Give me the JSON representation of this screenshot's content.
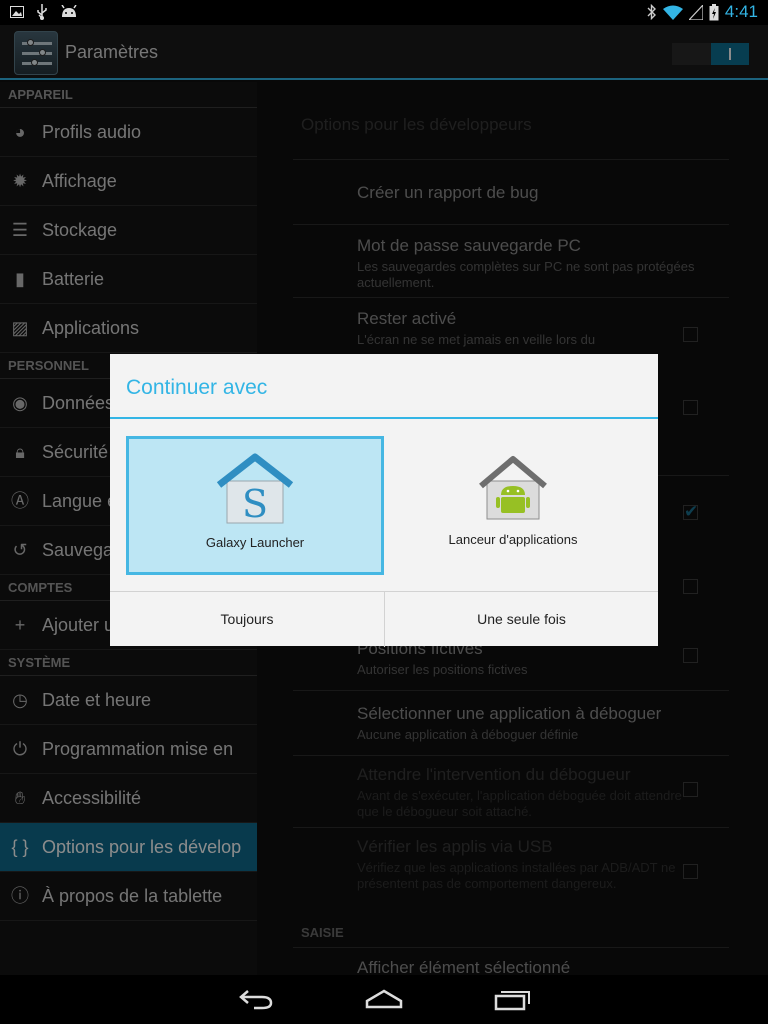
{
  "status_bar": {
    "time": "4:41",
    "left_icons": [
      "image-icon",
      "usb-icon",
      "android-debug-icon"
    ],
    "right_icons": [
      "bluetooth-icon",
      "wifi-icon",
      "signal-icon",
      "battery-icon"
    ]
  },
  "action_bar": {
    "title": "Paramètres",
    "app_icon": "settings-sliders-icon"
  },
  "sidebar": {
    "headers": {
      "appareil": "APPAREIL",
      "personnel": "PERSONNEL",
      "comptes": "COMPTES",
      "systeme": "SYSTÈME"
    },
    "items": [
      {
        "label": "Profils audio",
        "icon": "audio-profiles-icon"
      },
      {
        "label": "Affichage",
        "icon": "display-icon"
      },
      {
        "label": "Stockage",
        "icon": "storage-icon"
      },
      {
        "label": "Batterie",
        "icon": "battery-icon"
      },
      {
        "label": "Applications",
        "icon": "apps-icon"
      },
      {
        "label": "Données",
        "icon": "location-icon"
      },
      {
        "label": "Sécurité",
        "icon": "lock-icon"
      },
      {
        "label": "Langue e",
        "icon": "language-icon"
      },
      {
        "label": "Sauvega",
        "icon": "backup-icon"
      },
      {
        "label": "Ajouter un compte",
        "icon": "plus-icon"
      },
      {
        "label": "Date et heure",
        "icon": "clock-icon"
      },
      {
        "label": "Programmation mise en",
        "icon": "power-schedule-icon"
      },
      {
        "label": "Accessibilité",
        "icon": "hand-icon"
      },
      {
        "label": "Options pour les dévelop",
        "icon": "braces-icon"
      },
      {
        "label": "À propos de la tablette",
        "icon": "info-icon"
      }
    ]
  },
  "pane": {
    "title": "Options pour les développeurs",
    "prefs": [
      {
        "title": "Créer un rapport de bug",
        "summary": ""
      },
      {
        "title": "Mot de passe sauvegarde PC",
        "summary": "Les sauvegardes complètes sur PC ne sont pas protégées actuellement."
      },
      {
        "title": "Rester activé",
        "summary": "L'écran ne se met jamais en veille lors du"
      },
      {
        "title": "Positions fictives",
        "summary": "Autoriser les positions fictives"
      },
      {
        "title": "Sélectionner une application à déboguer",
        "summary": "Aucune application à déboguer définie"
      },
      {
        "title": "Attendre l'intervention du débogueur",
        "summary": "Avant de s'exécuter, l'application déboguée doit attendre que le débogueur soit attaché."
      },
      {
        "title": "Vérifier les applis via USB",
        "summary": "Vérifiez que les applications installées par ADB/ADT ne présentent pas de comportement dangereux."
      },
      {
        "title": "Afficher élément sélectionné",
        "summary": ""
      }
    ],
    "section_saisie": "SAISIE"
  },
  "dialog": {
    "title": "Continuer avec",
    "options": [
      {
        "label": "Galaxy Launcher",
        "icon": "galaxy-launcher-icon",
        "selected": true
      },
      {
        "label": "Lanceur d'applications",
        "icon": "android-launcher-icon",
        "selected": false
      }
    ],
    "always_label": "Toujours",
    "once_label": "Une seule fois",
    "galaxy_glyph": "S"
  },
  "nav_bar": {
    "icons": [
      "back-icon",
      "home-icon",
      "recents-icon"
    ]
  },
  "colors": {
    "accent": "#33b5e5",
    "selected_nav": "#0f6b8d",
    "dialog_bg": "#f3f3f3"
  }
}
